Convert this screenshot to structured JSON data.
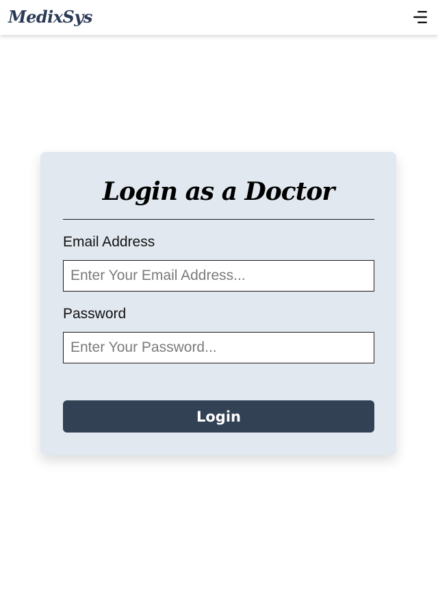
{
  "header": {
    "logo_text": "MedixSys",
    "menu_icon": "menu-icon"
  },
  "login_card": {
    "title": "Login as a Doctor",
    "email": {
      "label": "Email Address",
      "placeholder": "Enter Your Email Address...",
      "value": ""
    },
    "password": {
      "label": "Password",
      "placeholder": "Enter Your Password...",
      "value": ""
    },
    "submit_label": "Login"
  },
  "colors": {
    "brand": "#2b3a55",
    "card_background": "#e2e8f0",
    "button_background": "#334155",
    "button_text": "#ffffff"
  }
}
